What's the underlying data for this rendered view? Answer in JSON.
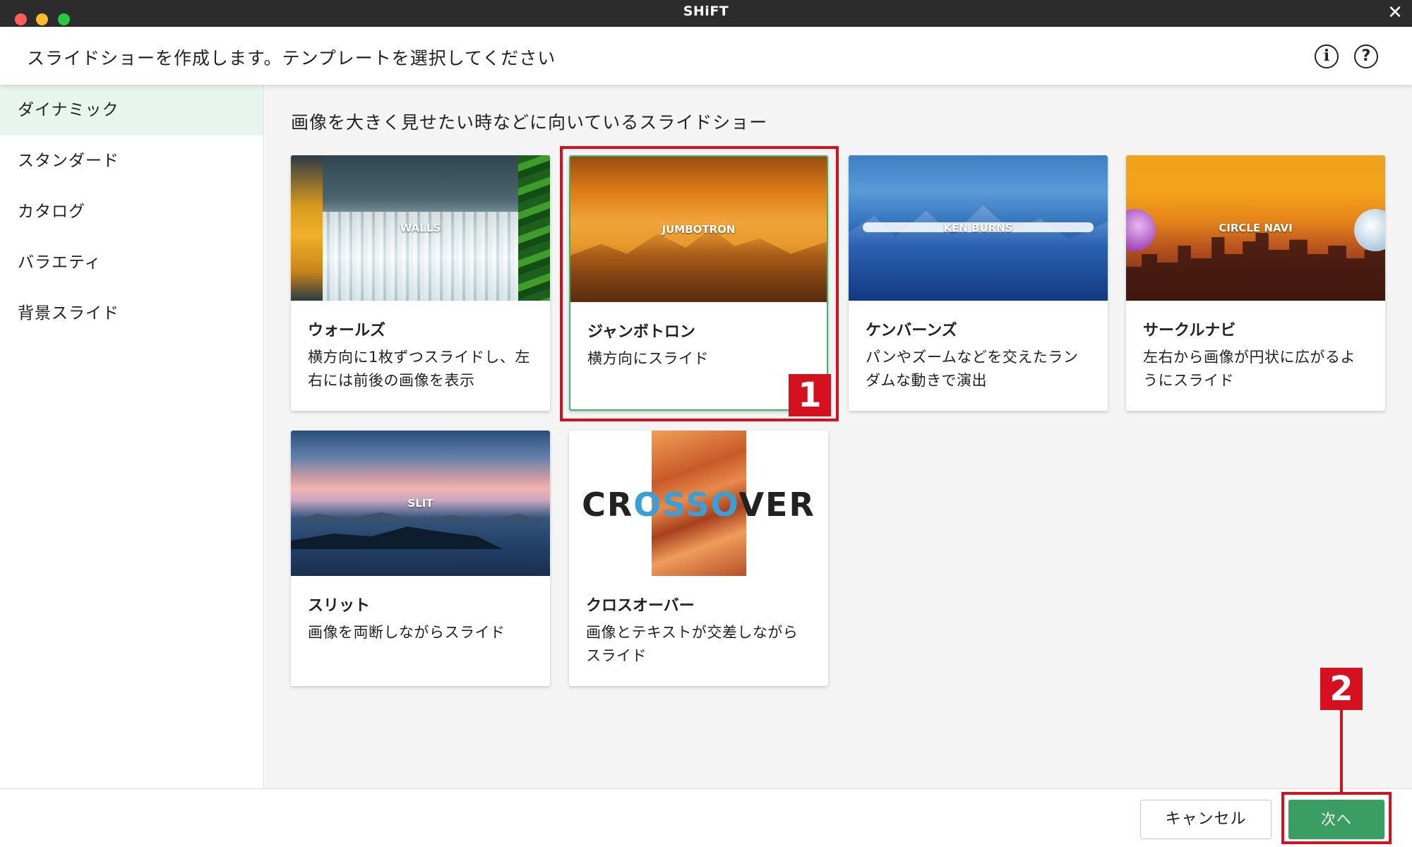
{
  "app": {
    "title": "SHiFT"
  },
  "header": {
    "title": "スライドショーを作成します。テンプレートを選択してください",
    "info_icon": "i",
    "help_icon": "?"
  },
  "sidebar": {
    "items": [
      {
        "label": "ダイナミック",
        "active": true
      },
      {
        "label": "スタンダード",
        "active": false
      },
      {
        "label": "カタログ",
        "active": false
      },
      {
        "label": "バラエティ",
        "active": false
      },
      {
        "label": "背景スライド",
        "active": false
      }
    ]
  },
  "main": {
    "title": "画像を大きく見せたい時などに向いているスライドショー",
    "templates": [
      {
        "thumb_label": "WALLS",
        "title": "ウォールズ",
        "desc": "横方向に1枚ずつスライドし、左右には前後の画像を表示"
      },
      {
        "thumb_label": "JUMBOTRON",
        "title": "ジャンボトロン",
        "desc": "横方向にスライド",
        "selected": true
      },
      {
        "thumb_label": "KEN BURNS",
        "title": "ケンバーンズ",
        "desc": "パンやズームなどを交えたランダムな動きで演出"
      },
      {
        "thumb_label": "CIRCLE NAVI",
        "title": "サークルナビ",
        "desc": "左右から画像が円状に広がるようにスライド"
      },
      {
        "thumb_label": "SLIT",
        "title": "スリット",
        "desc": "画像を両断しながらスライド"
      },
      {
        "thumb_label": "CROSSOVER",
        "title": "クロスオーバー",
        "desc": "画像とテキストが交差しながらスライド"
      }
    ]
  },
  "annotations": {
    "badge_1": "1",
    "badge_2": "2"
  },
  "footer": {
    "cancel_label": "キャンセル",
    "next_label": "次へ"
  },
  "colors": {
    "accent": "#3a9d62",
    "annotation": "#d5101f",
    "active_bg": "#e8f5ee",
    "titlebar": "#2c2c2c"
  }
}
